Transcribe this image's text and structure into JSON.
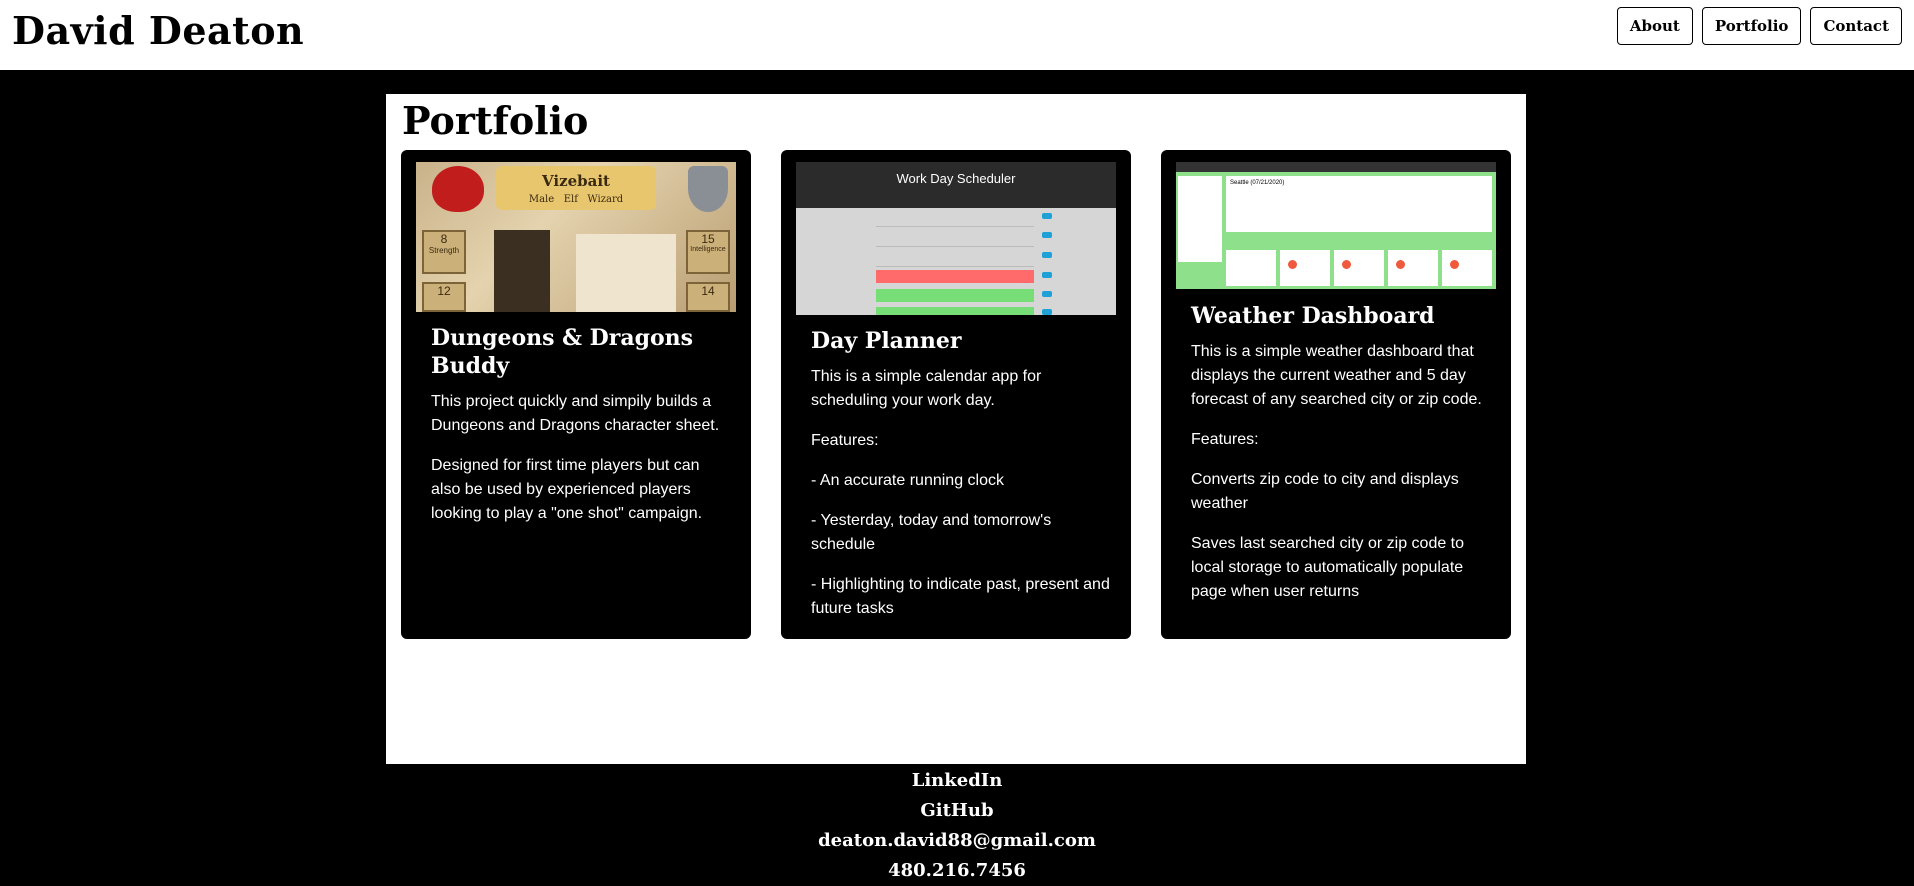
{
  "header": {
    "brand": "David Deaton",
    "nav": [
      {
        "label": "About"
      },
      {
        "label": "Portfolio"
      },
      {
        "label": "Contact"
      }
    ]
  },
  "main": {
    "title": "Portfolio",
    "cards": [
      {
        "title": "Dungeons & Dragons Buddy",
        "paragraphs": [
          "This project quickly and simpily builds a Dungeons and Dragons character sheet.",
          "Designed for first time players but can also be used by experienced players looking to play a \"one shot\" campaign."
        ],
        "thumb": {
          "name": "Vizebait",
          "subtitle": "Male   Elf   Wizard",
          "stats": [
            {
              "value": "8",
              "label": "Strength"
            },
            {
              "value": "15",
              "label": "Intelligence"
            },
            {
              "value": "12"
            },
            {
              "value": "14"
            }
          ]
        }
      },
      {
        "title": "Day Planner",
        "paragraphs": [
          "This is a simple calendar app for scheduling your work day.",
          "Features:",
          "- An accurate running clock",
          "- Yesterday, today and tomorrow's schedule",
          "- Highlighting to indicate past, present and future tasks"
        ],
        "thumb": {
          "title": "Work Day Scheduler"
        }
      },
      {
        "title": "Weather Dashboard",
        "paragraphs": [
          "This is a simple weather dashboard that displays the current weather and 5 day forecast of any searched city or zip code.",
          "Features:",
          "Converts zip code to city and displays weather",
          "Saves last searched city or zip code to local storage to automatically populate page when user returns"
        ],
        "thumb": {
          "city": "Seattle (07/21/2020)"
        }
      }
    ]
  },
  "footer": {
    "links": [
      {
        "label": "LinkedIn"
      },
      {
        "label": "GitHub"
      },
      {
        "label": "deaton.david88@gmail.com"
      },
      {
        "label": "480.216.7456"
      }
    ]
  },
  "colors": {
    "background": "#000000",
    "panel": "#ffffff",
    "schedule_past": "#ff6b6b",
    "schedule_future": "#77dd77",
    "weather_green": "#8ee08a"
  }
}
